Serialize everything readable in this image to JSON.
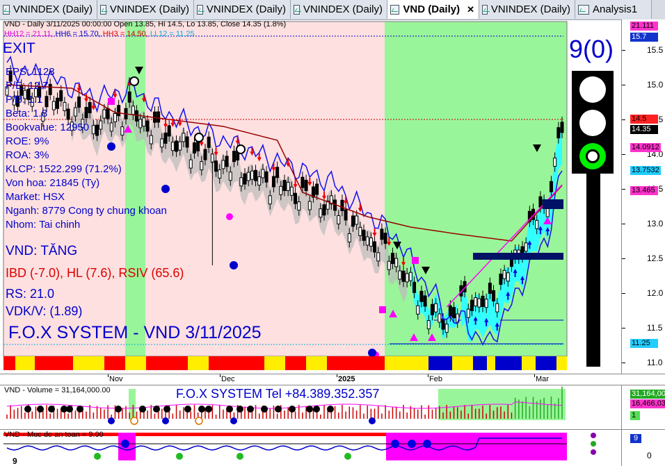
{
  "tabs": [
    {
      "label": "VNINDEX (Daily)",
      "active": false
    },
    {
      "label": "VNINDEX (Daily)",
      "active": false
    },
    {
      "label": "VNINDEX (Daily)",
      "active": false
    },
    {
      "label": "VNINDEX (Daily)",
      "active": false
    },
    {
      "label": "VND (Daily)",
      "active": true,
      "close": "✕"
    },
    {
      "label": "VNINDEX (Daily)",
      "active": false
    },
    {
      "label": "Analysis1",
      "active": false
    }
  ],
  "main": {
    "header": "VND - Daily 3/11/2025 00:00:00 Open 13.85, Hi 14.5, Lo 13.85, Close 14.35 (1.8%)",
    "hh_line": {
      "hh12": "HH12 = 21.11,",
      "hh6": "HH6 = 15.70,",
      "hh3": "HH3 = 14.50,",
      "ll12": "LL12 = 11.25"
    },
    "exit_label": "EXIT",
    "fundamentals": [
      "EPS: 1128",
      "P/E: 12.7",
      "P/B: 1.1",
      "Beta: 1.8",
      "Bookvalue: 12950",
      "ROE: 9%",
      "ROA: 3%",
      "KLCP: 1522.299 (71.2%)",
      "Von hoa: 21845 (Ty)",
      "Market: HSX",
      "Nganh: 8779 Cong ty chung khoan",
      "Nhom: Tai chinh"
    ],
    "status": "VND: TĂNG",
    "ibd": "IBD (-7.0), HL (7.6), RSIV (65.6)",
    "rs": "RS: 21.0",
    "vdk": "VDK/V:  (1.89)",
    "system_title": "F.O.X SYSTEM - VND 3/11/2025",
    "signal_count": "9(0)",
    "traffic_light": [
      "white",
      "white",
      "green"
    ],
    "price_axis": [
      "15.5",
      "15.0",
      "14.5",
      "14.0",
      "13.5",
      "13.0",
      "12.5",
      "12.0",
      "11.5",
      "11.0"
    ],
    "axis_tags": [
      {
        "text": "21.111",
        "bg": "#ff33cc",
        "fg": "#000"
      },
      {
        "text": "15.7",
        "bg": "#1133cc",
        "fg": "#fff"
      },
      {
        "text": "14.5",
        "bg": "#ff2222",
        "fg": "#000"
      },
      {
        "text": "14.35",
        "bg": "#000000",
        "fg": "#fff"
      },
      {
        "text": "14.0912",
        "bg": "#ff33cc",
        "fg": "#000"
      },
      {
        "text": "13.7532",
        "bg": "#22ccff",
        "fg": "#000"
      },
      {
        "text": "13.465",
        "bg": "#ff33cc",
        "fg": "#000"
      },
      {
        "text": "11.25",
        "bg": "#22ccff",
        "fg": "#000"
      }
    ]
  },
  "months": [
    "Nov",
    "Dec",
    "2025",
    "Feb",
    "Mar"
  ],
  "volume": {
    "header": "VND - Volume = 31,164,000.00",
    "tel": "F.O.X SYSTEM Tel +84.389.352.357",
    "axis_tags": [
      {
        "text": "31,164,00",
        "bg": "#22aa22",
        "fg": "#fff"
      },
      {
        "text": "16,466,03",
        "bg": "#ff33cc",
        "fg": "#000"
      },
      {
        "text": "1",
        "bg": "#55dd55",
        "fg": "#000"
      }
    ]
  },
  "safety": {
    "header": "VND - Muc do an toan = 9.00",
    "axis_tags": [
      {
        "text": "9",
        "bg": "#1133cc",
        "fg": "#fff"
      }
    ],
    "axis_zero": "0",
    "left_marker": "9"
  },
  "colors": {
    "pink_bg": "#ffe0e0",
    "green_bg": "#99f599",
    "blue_line": "#1111ee",
    "red_line": "#990000",
    "cyan_band": "#33ffff",
    "magenta": "#ff00ff",
    "navy": "#001166"
  }
}
